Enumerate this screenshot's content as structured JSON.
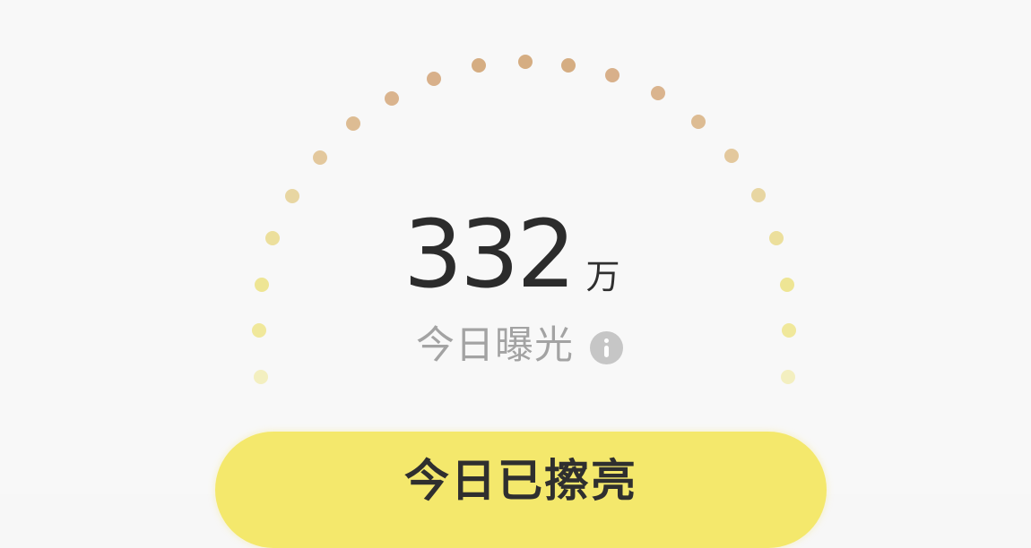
{
  "exposure": {
    "value": "332",
    "unit": "万",
    "label": "今日曝光",
    "info_icon": "info-icon"
  },
  "action": {
    "label": "今日已擦亮"
  },
  "colors": {
    "background": "#f8f8f8",
    "dot_dark": "#d5ad82",
    "dot_light": "#f1e79a",
    "button": "#f4e86c",
    "value_text": "#2c2c2c",
    "label_text": "#a3a3a3"
  }
}
